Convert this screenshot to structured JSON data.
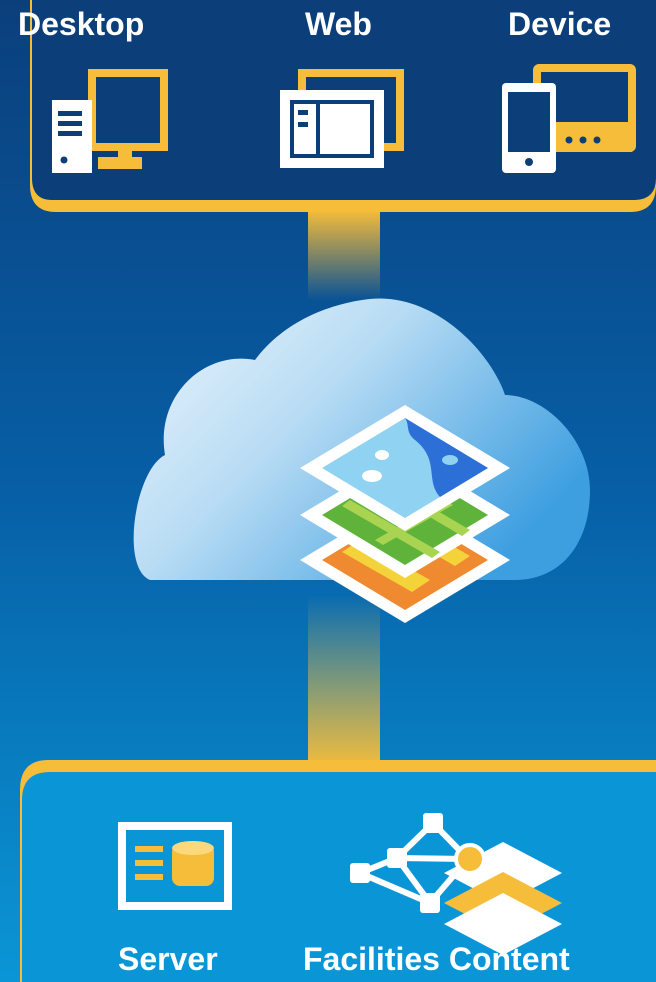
{
  "top_row": {
    "desktop_label": "Desktop",
    "web_label": "Web",
    "device_label": "Device"
  },
  "bottom_row": {
    "server_label": "Server",
    "facilities_label": "Facilities Content"
  },
  "icons": {
    "desktop": "desktop-computer-icon",
    "web": "browser-window-icon",
    "device": "phone-and-tablet-icon",
    "cloud": "cloud-icon",
    "map_layers": "stacked-map-layers-icon",
    "server": "server-database-icon",
    "facilities": "network-graph-layers-icon"
  },
  "colors": {
    "background_top": "#0b3f7c",
    "background_bottom": "#0a96d6",
    "accent_yellow": "#f6bd3a",
    "white": "#ffffff"
  }
}
